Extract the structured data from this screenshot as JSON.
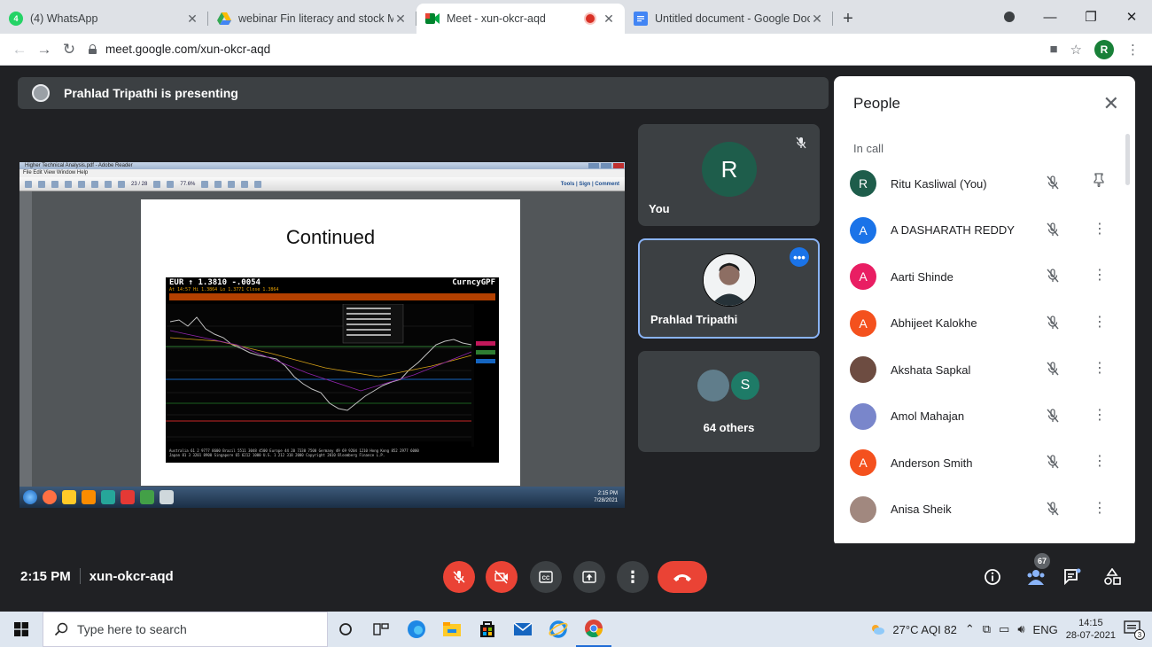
{
  "browser": {
    "tabs": [
      {
        "title": "(4) WhatsApp",
        "favicon_color": "#25d366",
        "favicon_glyph": "4",
        "active": false
      },
      {
        "title": "webinar Fin literacy and stock Mi",
        "favicon_color": "#fbbc04",
        "favicon_glyph": "",
        "active": false
      },
      {
        "title": "Meet - xun-okcr-aqd",
        "favicon_color": "#00832d",
        "favicon_glyph": "",
        "active": true,
        "recording": true
      },
      {
        "title": "Untitled document - Google Doc",
        "favicon_color": "#4285f4",
        "favicon_glyph": "",
        "active": false
      }
    ],
    "url": "meet.google.com/xun-okcr-aqd",
    "profile_initial": "R"
  },
  "meet": {
    "presenting_label": "Prahlad Tripathi is presenting",
    "shared_slide": {
      "window_title": "Higher Technical Analysis.pdf - Adobe Reader",
      "menu": "File  Edit  View  Window  Help",
      "toolbar_right": "Tools | Sign | Comment",
      "page_indicator": "23 / 28",
      "zoom": "77.6%",
      "slide_title": "Continued",
      "bb_line1": "EUR   ↑ 1.3810  -.0054",
      "bb_line1_right": "CurncyGPF",
      "bb_line2": "At 14:57 Hi 1.3864 Lo 1.3771 Close 1.3864",
      "clock_time": "2:15 PM",
      "clock_date": "7/28/2021"
    },
    "tiles": {
      "you": {
        "label": "You",
        "initial": "R"
      },
      "presenter": {
        "label": "Prahlad Tripathi"
      },
      "others": {
        "label": "64 others",
        "initial": "S"
      }
    },
    "people": {
      "heading": "People",
      "section": "In call",
      "participants": [
        {
          "name": "Ritu Kasliwal (You)",
          "initial": "R",
          "color": "#1e5d4b",
          "action": "pin"
        },
        {
          "name": "A DASHARATH REDDY",
          "initial": "A",
          "color": "#1a73e8",
          "action": "more"
        },
        {
          "name": "Aarti Shinde",
          "initial": "A",
          "color": "#e91e63",
          "action": "more"
        },
        {
          "name": "Abhijeet Kalokhe",
          "initial": "A",
          "color": "#f4511e",
          "action": "more"
        },
        {
          "name": "Akshata Sapkal",
          "initial": "",
          "color": "#6d4c41",
          "action": "more"
        },
        {
          "name": "Amol Mahajan",
          "initial": "",
          "color": "#7986cb",
          "action": "more"
        },
        {
          "name": "Anderson Smith",
          "initial": "A",
          "color": "#f4511e",
          "action": "more"
        },
        {
          "name": "Anisa Sheik",
          "initial": "",
          "color": "#a1887f",
          "action": "more"
        }
      ]
    },
    "bottom": {
      "time": "2:15 PM",
      "meeting_code": "xun-okcr-aqd",
      "people_count": "67"
    }
  },
  "taskbar": {
    "search_placeholder": "Type here to search",
    "weather": "27°C  AQI 82",
    "lang": "ENG",
    "time": "14:15",
    "date": "28-07-2021",
    "notifications": "3"
  }
}
